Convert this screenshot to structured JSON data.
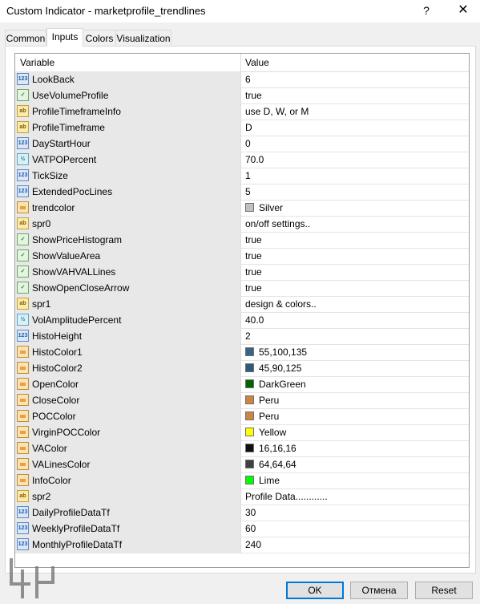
{
  "window": {
    "title": "Custom Indicator - marketprofile_trendlines",
    "help_label": "?",
    "close_label": "✕"
  },
  "tabs": [
    "Common",
    "Inputs",
    "Colors",
    "Visualization"
  ],
  "active_tab": "Inputs",
  "grid": {
    "header_variable": "Variable",
    "header_value": "Value",
    "rows": [
      {
        "icon": "int",
        "icon_text": "123",
        "name": "LookBack",
        "value": "6"
      },
      {
        "icon": "bool",
        "icon_text": "✓",
        "name": "UseVolumeProfile",
        "value": "true"
      },
      {
        "icon": "str",
        "icon_text": "ab",
        "name": "ProfileTimeframeInfo",
        "value": "use D, W, or M"
      },
      {
        "icon": "str",
        "icon_text": "ab",
        "name": "ProfileTimeframe",
        "value": "D"
      },
      {
        "icon": "int",
        "icon_text": "123",
        "name": "DayStartHour",
        "value": "0"
      },
      {
        "icon": "dbl",
        "icon_text": "½",
        "name": "VATPOPercent",
        "value": "70.0"
      },
      {
        "icon": "int",
        "icon_text": "123",
        "name": "TickSize",
        "value": "1"
      },
      {
        "icon": "int",
        "icon_text": "123",
        "name": "ExtendedPocLines",
        "value": "5"
      },
      {
        "icon": "clr",
        "icon_text": "",
        "name": "trendcolor",
        "value": "Silver",
        "swatch": "#c0c0c0"
      },
      {
        "icon": "str",
        "icon_text": "ab",
        "name": "spr0",
        "value": "on/off settings.."
      },
      {
        "icon": "bool",
        "icon_text": "✓",
        "name": "ShowPriceHistogram",
        "value": "true"
      },
      {
        "icon": "bool",
        "icon_text": "✓",
        "name": "ShowValueArea",
        "value": "true"
      },
      {
        "icon": "bool",
        "icon_text": "✓",
        "name": "ShowVAHVALLines",
        "value": "true"
      },
      {
        "icon": "bool",
        "icon_text": "✓",
        "name": "ShowOpenCloseArrow",
        "value": "true"
      },
      {
        "icon": "str",
        "icon_text": "ab",
        "name": "spr1",
        "value": "design & colors.."
      },
      {
        "icon": "dbl",
        "icon_text": "½",
        "name": "VolAmplitudePercent",
        "value": "40.0"
      },
      {
        "icon": "int",
        "icon_text": "123",
        "name": "HistoHeight",
        "value": "2"
      },
      {
        "icon": "clr",
        "icon_text": "",
        "name": "HistoColor1",
        "value": "55,100,135",
        "swatch": "#376487"
      },
      {
        "icon": "clr",
        "icon_text": "",
        "name": "HistoColor2",
        "value": "45,90,125",
        "swatch": "#2d5a7d"
      },
      {
        "icon": "clr",
        "icon_text": "",
        "name": "OpenColor",
        "value": "DarkGreen",
        "swatch": "#006400"
      },
      {
        "icon": "clr",
        "icon_text": "",
        "name": "CloseColor",
        "value": "Peru",
        "swatch": "#cd853f"
      },
      {
        "icon": "clr",
        "icon_text": "",
        "name": "POCColor",
        "value": "Peru",
        "swatch": "#cd853f"
      },
      {
        "icon": "clr",
        "icon_text": "",
        "name": "VirginPOCColor",
        "value": "Yellow",
        "swatch": "#ffff00"
      },
      {
        "icon": "clr",
        "icon_text": "",
        "name": "VAColor",
        "value": "16,16,16",
        "swatch": "#101010"
      },
      {
        "icon": "clr",
        "icon_text": "",
        "name": "VALinesColor",
        "value": "64,64,64",
        "swatch": "#404040"
      },
      {
        "icon": "clr",
        "icon_text": "",
        "name": "InfoColor",
        "value": "Lime",
        "swatch": "#00ff00"
      },
      {
        "icon": "str",
        "icon_text": "ab",
        "name": "spr2",
        "value": "Profile Data............"
      },
      {
        "icon": "int",
        "icon_text": "123",
        "name": "DailyProfileDataTf",
        "value": "30"
      },
      {
        "icon": "int",
        "icon_text": "123",
        "name": "WeeklyProfileDataTf",
        "value": "60"
      },
      {
        "icon": "int",
        "icon_text": "123",
        "name": "MonthlyProfileDataTf",
        "value": "240"
      }
    ]
  },
  "buttons": {
    "ok": "OK",
    "cancel": "Отмена",
    "reset": "Reset"
  }
}
